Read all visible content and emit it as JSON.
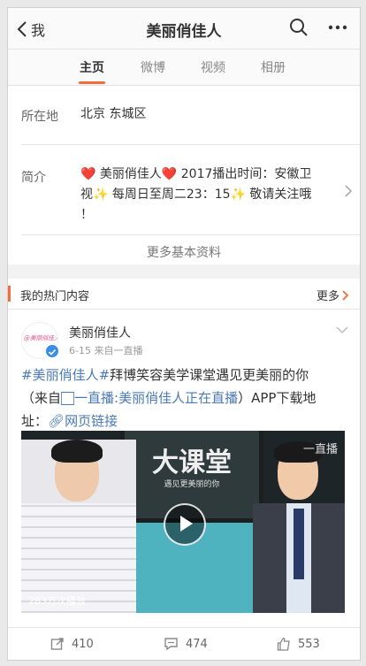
{
  "navbar": {
    "back_label": "我",
    "title": "美丽俏佳人"
  },
  "tabs": [
    {
      "label": "主页"
    },
    {
      "label": "微博"
    },
    {
      "label": "视频"
    },
    {
      "label": "相册"
    }
  ],
  "profile": {
    "location_label": "所在地",
    "location_value": "北京 东城区",
    "intro_label": "简介",
    "intro_line1": "❤️ 美丽俏佳人❤️ 2017播出时间：安徽卫",
    "intro_line2": "视✨ 每周日至周二23：15✨ 敬请关注哦",
    "intro_line3": "！",
    "more_info": "更多基本资料"
  },
  "hot_section": {
    "title": "我的热门内容",
    "more": "更多"
  },
  "post": {
    "author": "美丽俏佳人",
    "avatar_text": "@美丽俏佳人",
    "date": "6-15",
    "source": "来自一直播",
    "text_hashtag": "#美丽俏佳人#",
    "text_body": "拜博笑容美学课堂遇见更美丽的你",
    "text_from_prefix": "（来自",
    "text_from_link": "一直播:美丽俏佳人正在直播",
    "text_from_suffix": "）APP下载地",
    "text_line3_prefix": "址：",
    "text_link": "网页链接",
    "video": {
      "board_title": "大课堂",
      "board_subtitle": "遇见更美丽的你",
      "watermark": "一直播",
      "views": "283万次播放"
    },
    "actions": {
      "repost": "410",
      "comment": "474",
      "like": "553"
    }
  }
}
